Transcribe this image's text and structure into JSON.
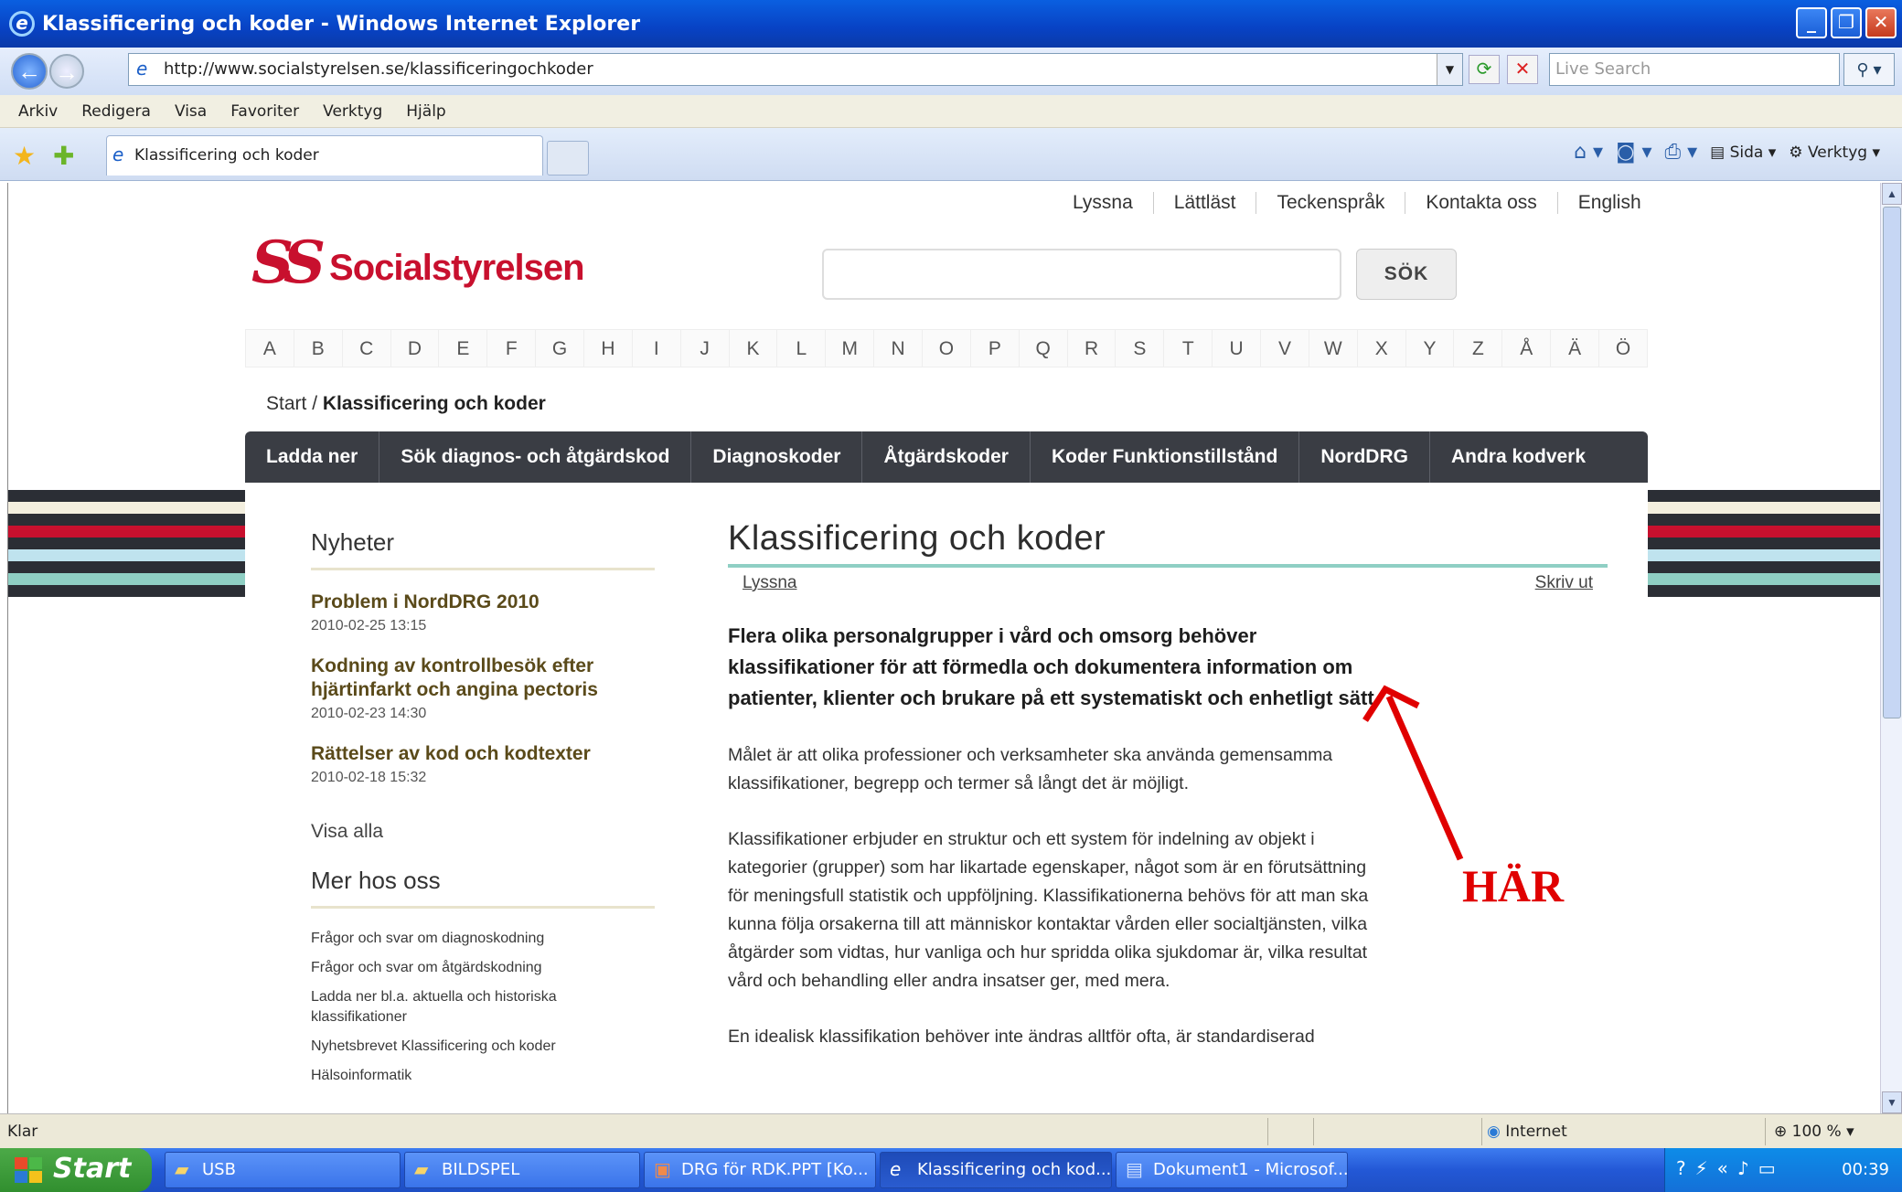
{
  "window": {
    "title": "Klassificering och koder - Windows Internet Explorer",
    "address": "http://www.socialstyrelsen.se/klassificeringochkoder",
    "search_placeholder": "Live Search",
    "menu": [
      "Arkiv",
      "Redigera",
      "Visa",
      "Favoriter",
      "Verktyg",
      "Hjälp"
    ],
    "tab_title": "Klassificering och koder",
    "cmd": {
      "sida": "Sida",
      "verktyg": "Verktyg"
    }
  },
  "site": {
    "top_links": [
      "Lyssna",
      "Lättläst",
      "Teckenspråk",
      "Kontakta oss",
      "English"
    ],
    "logo_mark": "SS",
    "logo_text": "Socialstyrelsen",
    "search_button": "SÖK",
    "alphabet": [
      "A",
      "B",
      "C",
      "D",
      "E",
      "F",
      "G",
      "H",
      "I",
      "J",
      "K",
      "L",
      "M",
      "N",
      "O",
      "P",
      "Q",
      "R",
      "S",
      "T",
      "U",
      "V",
      "W",
      "X",
      "Y",
      "Z",
      "Å",
      "Ä",
      "Ö"
    ],
    "breadcrumb": {
      "start": "Start",
      "sep": "/",
      "current": "Klassificering och koder"
    },
    "mainnav": [
      "Ladda ner",
      "Sök diagnos- och åtgärdskod",
      "Diagnoskoder",
      "Åtgärdskoder",
      "Koder Funktionstillstånd",
      "NordDRG",
      "Andra kodverk"
    ]
  },
  "left": {
    "news_heading": "Nyheter",
    "news": [
      {
        "title": "Problem i NordDRG 2010",
        "date": "2010-02-25 13:15"
      },
      {
        "title": "Kodning av kontrollbesök efter hjärtinfarkt och angina pectoris",
        "date": "2010-02-23 14:30"
      },
      {
        "title": "Rättelser av kod och kodtexter",
        "date": "2010-02-18 15:32"
      }
    ],
    "show_all": "Visa alla",
    "more_heading": "Mer hos oss",
    "more_links": [
      "Frågor och svar om diagnoskodning",
      "Frågor och svar om åtgärdskodning",
      "Ladda ner bl.a. aktuella och historiska klassifikationer",
      "Nyhetsbrevet Klassificering och koder",
      "Hälsoinformatik"
    ]
  },
  "content": {
    "title": "Klassificering och koder",
    "listen": "Lyssna",
    "print": "Skriv ut",
    "lead": "Flera olika personalgrupper i vård och omsorg behöver klassifikationer för att förmedla och dokumentera information om patienter, klienter och brukare på ett systematiskt och enhetligt sätt.",
    "p1": "Målet är att olika professioner och verksamheter ska använda gemensamma klassifikationer, begrepp och termer så långt det är möjligt.",
    "p2": "Klassifikationer erbjuder en struktur och ett system för indelning av objekt i kategorier (grupper) som har likartade egenskaper, något som är en förutsättning för meningsfull statistik och uppföljning. Klassifikationerna behövs för att man ska kunna följa orsakerna till att människor kontaktar vården eller socialtjänsten, vilka åtgärder som vidtas, hur vanliga och hur spridda olika sjukdomar är, vilka resultat vård och behandling eller andra insatser ger, med mera.",
    "p3": "En idealisk klassifikation behöver inte ändras alltför ofta, är standardiserad"
  },
  "annotation": {
    "label": "HÄR",
    "color": "#e00000"
  },
  "status": {
    "left": "Klar",
    "zone": "Internet",
    "zoom": "100 %"
  },
  "taskbar": {
    "start": "Start",
    "items": [
      "USB",
      "BILDSPEL",
      "DRG för RDK.PPT [Ko...",
      "Klassificering och kod...",
      "Dokument1 - Microsof..."
    ],
    "clock": "00:39"
  },
  "colors": {
    "brand_red": "#c8102e",
    "nav_dark": "#3a3d44",
    "accent_teal": "#8fcfc4"
  }
}
